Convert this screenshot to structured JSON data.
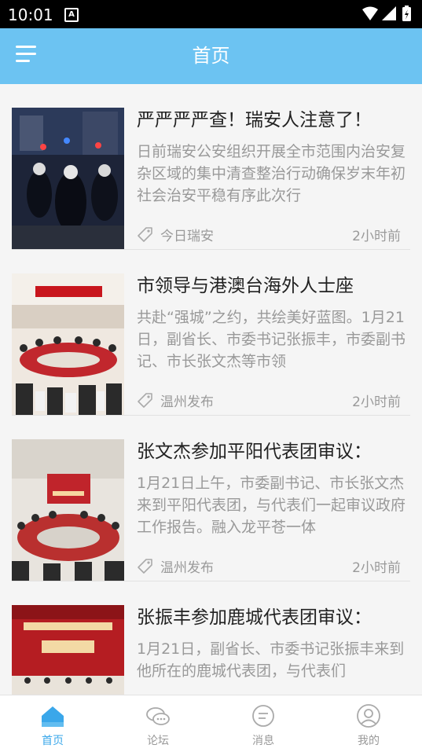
{
  "status_bar": {
    "time": "10:01",
    "notification_icon": "A",
    "icons": [
      "wifi-icon",
      "signal-icon",
      "battery-icon"
    ]
  },
  "app_bar": {
    "title": "首页",
    "menu_icon": "menu-icon"
  },
  "news": [
    {
      "title": "严严严严查！瑞安人注意了！",
      "summary": "日前瑞安公安组织开展全市范围内治安复杂区域的集中清查整治行动确保岁末年初社会治安平稳有序此次行",
      "source": "今日瑞安",
      "time": "2小时前"
    },
    {
      "title": "市领导与港澳台海外人士座",
      "summary": "共赴“强城”之约，共绘美好蓝图。1月21日，副省长、市委书记张振丰，市委副书记、市长张文杰等市领",
      "source": "温州发布",
      "time": "2小时前"
    },
    {
      "title": "张文杰参加平阳代表团审议：",
      "summary": "1月21日上午，市委副书记、市长张文杰来到平阳代表团，与代表们一起审议政府工作报告。融入龙平苍一体",
      "source": "温州发布",
      "time": "2小时前"
    },
    {
      "title": "张振丰参加鹿城代表团审议：",
      "summary": "1月21日，副省长、市委书记张振丰来到他所在的鹿城代表团，与代表们",
      "source": "",
      "time": ""
    }
  ],
  "tabs": [
    {
      "label": "首页",
      "icon": "home-icon",
      "active": true
    },
    {
      "label": "论坛",
      "icon": "chat-icon",
      "active": false
    },
    {
      "label": "消息",
      "icon": "message-icon",
      "active": false
    },
    {
      "label": "我的",
      "icon": "user-icon",
      "active": false
    }
  ],
  "colors": {
    "primary": "#6cc3f2",
    "active_tab": "#3aa7ea",
    "inactive": "#999999"
  }
}
